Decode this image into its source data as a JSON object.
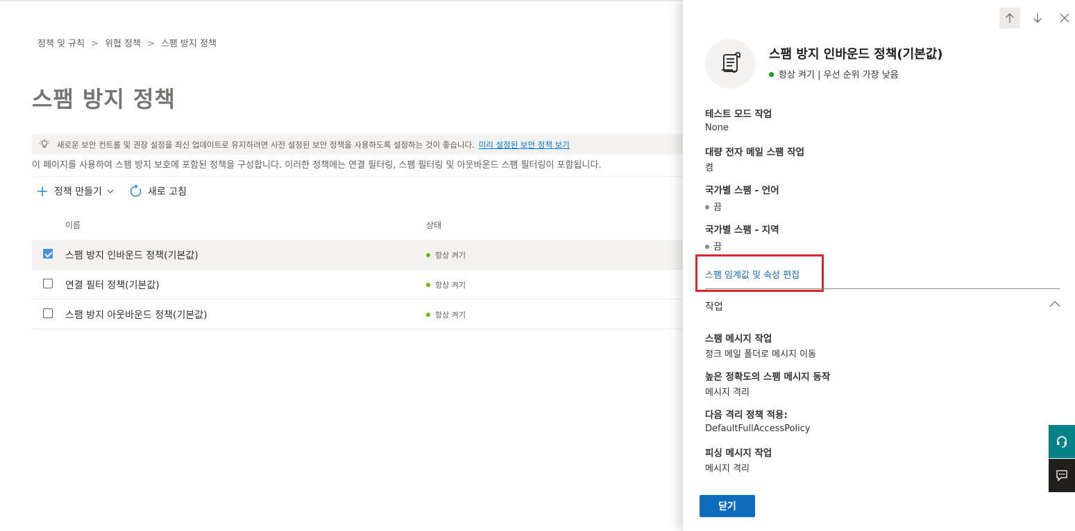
{
  "breadcrumb": [
    "정책 및 규칙",
    "위협 정책",
    "스팸 방지 정책"
  ],
  "page_title": "스팸 방지 정책",
  "banner": {
    "text": "새로운 보안 컨트롤 및 권장 설정을 최신 업데이트로 유지하려면 사전 설정된 보안 정책을 사용하도록 설정하는 것이 좋습니다.",
    "link": "미리 설정된 보안 정책 보기",
    "icon": "lightbulb-icon"
  },
  "description": "이 페이지를 사용하여 스팸 방지 보호에 포함된 정책을 구성합니다. 이러한 정책에는 연결 필터링, 스팸 필터링 및 아웃바운드 스팸 필터링이 포함됩니다.",
  "toolbar": {
    "create_label": "정책 만들기",
    "refresh_label": "새로 고침"
  },
  "table": {
    "columns": {
      "name": "이름",
      "status": "상태"
    },
    "rows": [
      {
        "name": "스팸 방지 인바운드 정책(기본값)",
        "status": "항상 켜기",
        "checked": true
      },
      {
        "name": "연결 필터 정책(기본값)",
        "status": "항상 켜기",
        "checked": false
      },
      {
        "name": "스팸 방지 아웃바운드 정책(기본값)",
        "status": "항상 켜기",
        "checked": false
      }
    ]
  },
  "panel": {
    "title": "스팸 방지 인바운드 정책(기본값)",
    "subtitle": "항상 켜기 | 우선 순위 가장 낮음",
    "icon": "scroll-policy-icon",
    "fields": [
      {
        "label": "테스트 모드 작업",
        "value": "None"
      },
      {
        "label": "대량 전자 메일 스팸 작업",
        "value": "켬"
      },
      {
        "label": "국가별 스팸 - 언어",
        "value": "끔"
      },
      {
        "label": "국가별 스팸 - 지역",
        "value": "끔"
      }
    ],
    "edit_link": "스팸 임계값 및 속성 편집",
    "section_title": "작업",
    "actions": [
      {
        "label": "스팸 메시지 작업",
        "value": "정크 메일 폴더로 메시지 이동"
      },
      {
        "label": "높은 정확도의 스팸 메시지 동작",
        "value": "메시지 격리"
      },
      {
        "label": "다음 격리 정책 적용:",
        "value": "DefaultFullAccessPolicy"
      },
      {
        "label": "피싱 메시지 작업",
        "value": "메시지 격리"
      }
    ],
    "close_label": "닫기"
  },
  "colors": {
    "accent": "#0f6cbd",
    "highlight_border": "#e0202a",
    "status_green": "#6bb700",
    "help_teal": "#038387"
  }
}
